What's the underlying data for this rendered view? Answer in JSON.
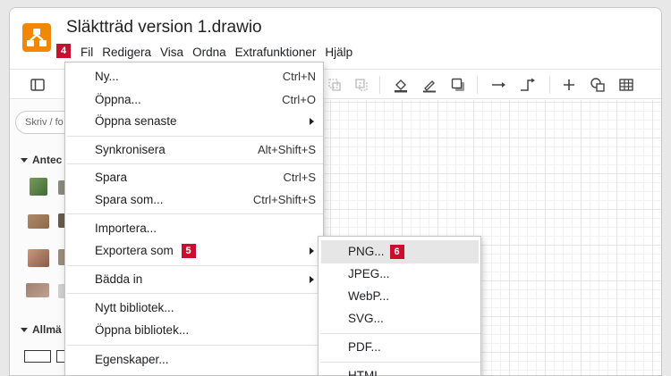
{
  "window": {
    "title": "Släktträd version 1.drawio"
  },
  "menubar": {
    "items": [
      "Fil",
      "Redigera",
      "Visa",
      "Ordna",
      "Extrafunktioner",
      "Hjälp"
    ]
  },
  "badges": {
    "step4": "4",
    "step5": "5",
    "step6": "6"
  },
  "sidebar": {
    "search_placeholder": "Skriv / fo",
    "section1": "Antec",
    "section2": "Allmä"
  },
  "file_menu": {
    "new": {
      "label": "Ny...",
      "shortcut": "Ctrl+N"
    },
    "open": {
      "label": "Öppna...",
      "shortcut": "Ctrl+O"
    },
    "open_recent": {
      "label": "Öppna senaste"
    },
    "sync": {
      "label": "Synkronisera",
      "shortcut": "Alt+Shift+S"
    },
    "save": {
      "label": "Spara",
      "shortcut": "Ctrl+S"
    },
    "save_as": {
      "label": "Spara som...",
      "shortcut": "Ctrl+Shift+S"
    },
    "import": {
      "label": "Importera..."
    },
    "export_as": {
      "label": "Exportera som"
    },
    "embed": {
      "label": "Bädda in"
    },
    "new_library": {
      "label": "Nytt bibliotek..."
    },
    "open_library": {
      "label": "Öppna bibliotek..."
    },
    "properties": {
      "label": "Egenskaper..."
    }
  },
  "export_submenu": {
    "png": "PNG...",
    "jpeg": "JPEG...",
    "webp": "WebP...",
    "svg": "SVG...",
    "pdf": "PDF...",
    "html": "HTML..."
  },
  "colors": {
    "brand": "#f08705",
    "badge": "#c8102e",
    "hover": "#e6e6e6"
  }
}
